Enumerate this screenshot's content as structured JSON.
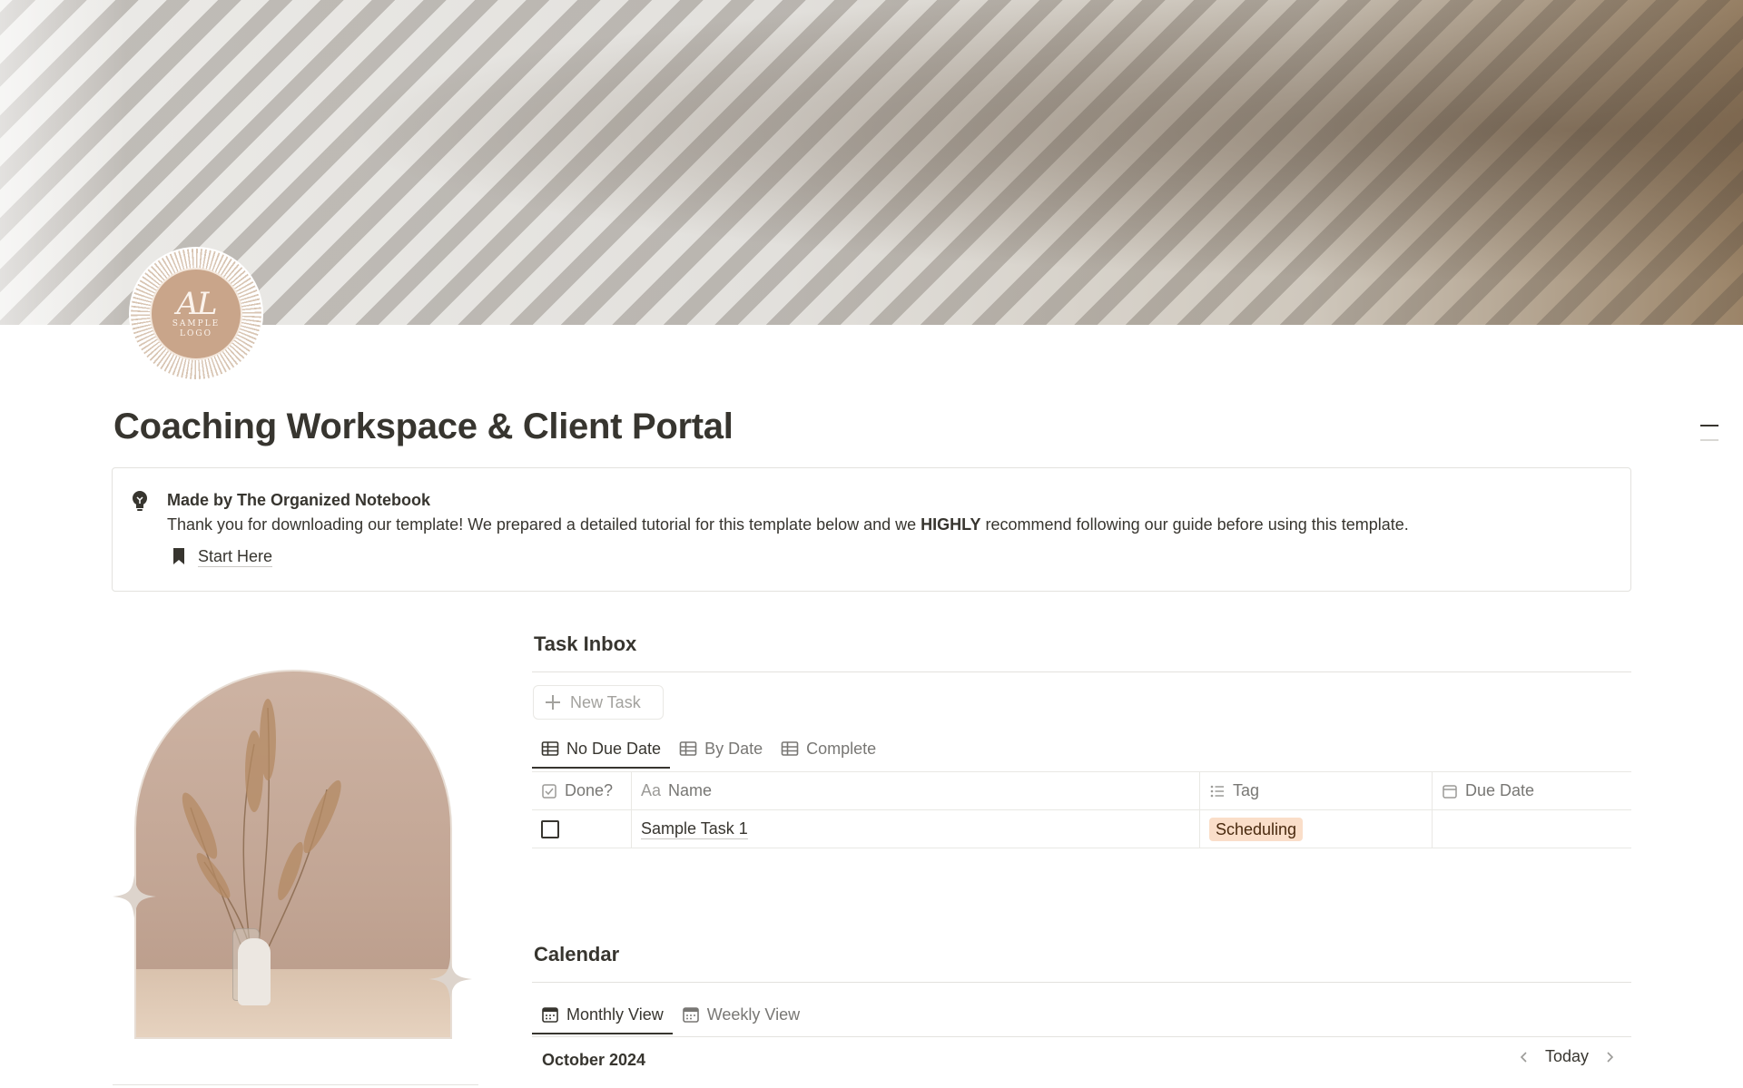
{
  "page": {
    "title": "Coaching Workspace & Client Portal"
  },
  "logo": {
    "monogram": "AL",
    "line1": "SAMPLE",
    "line2": "LOGO"
  },
  "callout": {
    "icon": "lightbulb-icon",
    "title": "Made by The Organized Notebook",
    "text_before": "Thank you for downloading our template! We prepared a detailed tutorial for this template below and we ",
    "text_bold": "HIGHLY",
    "text_after": " recommend following our guide before using this template.",
    "link_label": "Start Here",
    "link_icon": "bookmark-icon"
  },
  "task_inbox": {
    "title": "Task Inbox",
    "new_button_label": "New Task",
    "tabs": [
      {
        "label": "No Due Date",
        "active": true,
        "icon": "table-icon"
      },
      {
        "label": "By Date",
        "active": false,
        "icon": "table-icon"
      },
      {
        "label": "Complete",
        "active": false,
        "icon": "table-icon"
      }
    ],
    "columns": [
      {
        "label": "Done?",
        "icon": "checkbox-property-icon"
      },
      {
        "label": "Name",
        "icon": "text-property-icon",
        "icon_text": "Aa"
      },
      {
        "label": "Tag",
        "icon": "list-property-icon"
      },
      {
        "label": "Due Date",
        "icon": "calendar-property-icon"
      }
    ],
    "rows": [
      {
        "done": false,
        "name": "Sample Task 1",
        "tag": "Scheduling",
        "due_date": ""
      }
    ],
    "tag_color": "#fadec9"
  },
  "calendar": {
    "title": "Calendar",
    "tabs": [
      {
        "label": "Monthly View",
        "active": true,
        "icon": "calendar-icon"
      },
      {
        "label": "Weekly View",
        "active": false,
        "icon": "calendar-icon"
      }
    ],
    "month_label": "October 2024",
    "today_label": "Today"
  },
  "colors": {
    "text": "#37352f",
    "muted": "#787774",
    "border": "#e9e8e4",
    "logo_bg": "#c9a58a"
  }
}
